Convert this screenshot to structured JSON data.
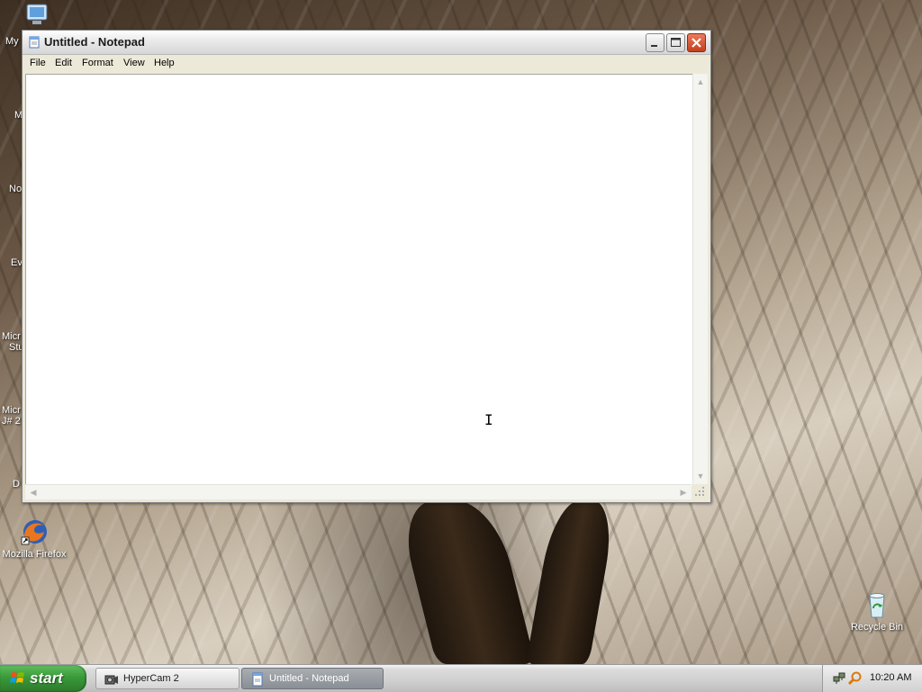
{
  "desktop": {
    "icons": [
      {
        "label": "Mozilla Firefox"
      },
      {
        "label": "Recycle Bin"
      }
    ],
    "edge_labels": [
      "My",
      "M",
      "No",
      "Ev",
      "Micr",
      "Stu",
      "Micr",
      "J# 2",
      "D"
    ]
  },
  "notepad": {
    "title": "Untitled - Notepad",
    "menu": [
      "File",
      "Edit",
      "Format",
      "View",
      "Help"
    ],
    "content": ""
  },
  "taskbar": {
    "start_label": "start",
    "tasks": [
      {
        "label": "HyperCam 2",
        "active": false
      },
      {
        "label": "Untitled - Notepad",
        "active": true
      }
    ],
    "clock": "10:20 AM"
  },
  "colors": {
    "start_green": "#3a9a3a",
    "close_red": "#c4401c",
    "active_task": "#8a8f95"
  }
}
